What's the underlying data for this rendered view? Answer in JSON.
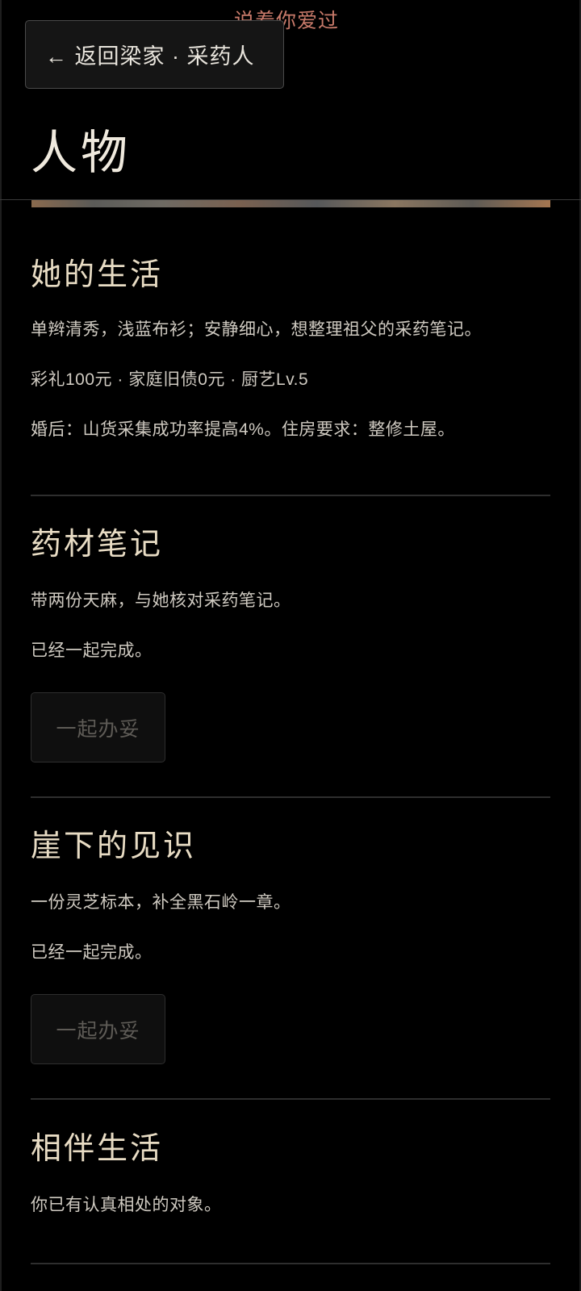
{
  "top_caption": "说着你爱过",
  "header": {
    "back_button_label": "← 返回梁家 · 采药人",
    "page_title": "人物"
  },
  "sections": [
    {
      "heading": "她的生活",
      "lines": [
        "单辫清秀，浅蓝布衫；安静细心，想整理祖父的采药笔记。",
        "彩礼100元 · 家庭旧债0元 · 厨艺Lv.5",
        "婚后：山货采集成功率提高4%。住房要求：整修土屋。"
      ]
    },
    {
      "heading": "药材笔记",
      "lines": [
        "带两份天麻，与她核对采药笔记。",
        "已经一起完成。"
      ],
      "button_label": "一起办妥"
    },
    {
      "heading": "崖下的见识",
      "lines": [
        "一份灵芝标本，补全黑石岭一章。",
        "已经一起完成。"
      ],
      "button_label": "一起办妥"
    },
    {
      "heading": "相伴生活",
      "lines": [
        "你已有认真相处的对象。"
      ]
    }
  ]
}
